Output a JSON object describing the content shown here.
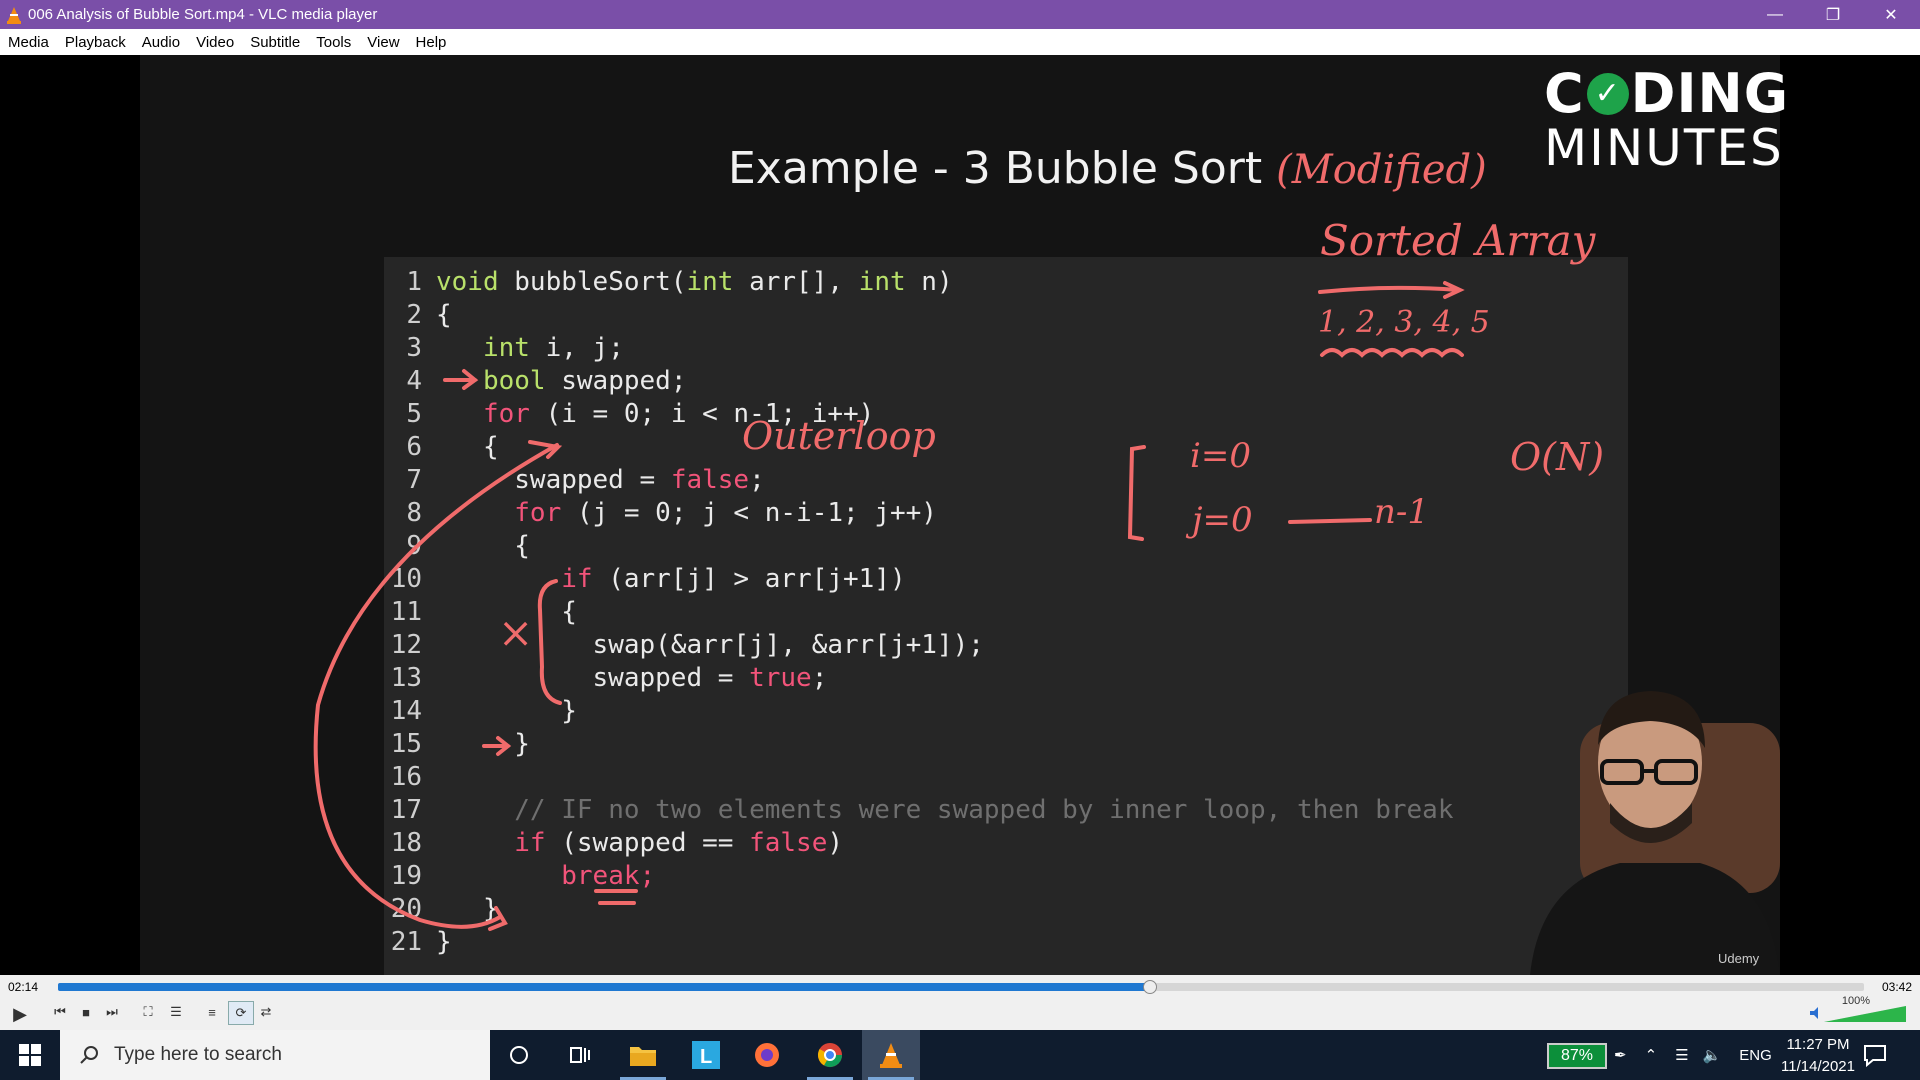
{
  "window": {
    "title": "006 Analysis of Bubble Sort.mp4 - VLC media player"
  },
  "menu": [
    "Media",
    "Playback",
    "Audio",
    "Video",
    "Subtitle",
    "Tools",
    "View",
    "Help"
  ],
  "slide": {
    "title": "Example - 3 Bubble Sort",
    "annotation_title": "(Modified)",
    "logo_line1_a": "C",
    "logo_line1_b": "DING",
    "logo_line2": "MINUTES",
    "code_lines": [
      "void bubbleSort(int arr[], int n)",
      "{",
      "int i, j;",
      "bool swapped;",
      "for (i = 0; i < n-1; i++)",
      "{",
      "swapped = false;",
      "for (j = 0; j < n-i-1; j++)",
      "{",
      "if (arr[j] > arr[j+1])",
      "{",
      "swap(&arr[j], &arr[j+1]);",
      "swapped = true;",
      "}",
      "}",
      "",
      "// IF no two elements were swapped by inner loop, then break",
      "if (swapped == false)",
      "break;",
      "}",
      "}"
    ],
    "handwriting": {
      "sorted_array": "Sorted Array",
      "array_values": "1, 2, 3, 4, 5",
      "outer_loop": "Outerloop",
      "i_eq": "i=0",
      "j_eq": "j=0",
      "n_minus_1": "n-1",
      "big_o": "O(N)",
      "x_mark": "×"
    },
    "watermark": "Udemy"
  },
  "player": {
    "elapsed": "02:14",
    "duration": "03:42",
    "progress": 0.604,
    "volume_label": "100%",
    "volume": 1.0
  },
  "taskbar": {
    "search_placeholder": "Type here to search",
    "battery": "87%",
    "language": "ENG",
    "time": "11:27 PM",
    "date": "11/14/2021"
  },
  "colors": {
    "titlebar": "#7a4fa8",
    "seek_fill": "#1f78d1",
    "ink": "#f06b6b",
    "keyword_type": "#b9e16a",
    "keyword_flow": "#f2547a"
  }
}
